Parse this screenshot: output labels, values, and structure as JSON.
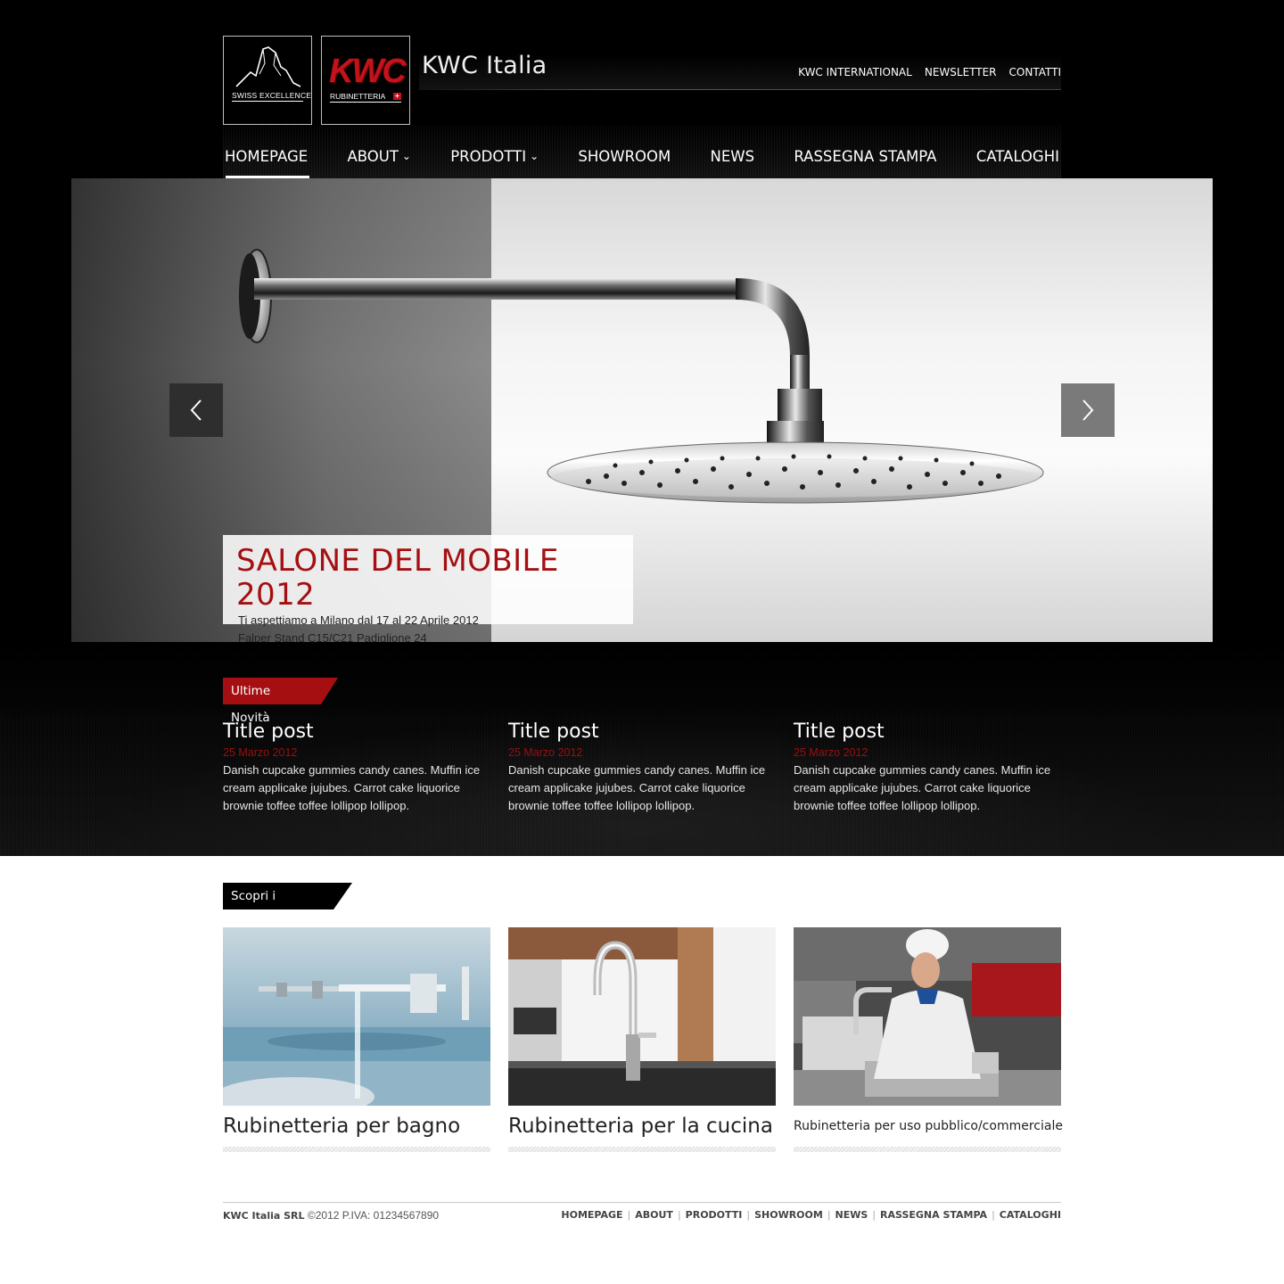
{
  "header": {
    "title": "KWC Italia",
    "logo_swiss_caption": "SWISS EXCELLENCE",
    "logo_kwc_mark": "KWC",
    "logo_kwc_caption": "RUBINETTERIA",
    "top_links": [
      "KWC INTERNATIONAL",
      "NEWSLETTER",
      "CONTATTI"
    ]
  },
  "nav": {
    "items": [
      {
        "label": "HOMEPAGE",
        "active": true
      },
      {
        "label": "ABOUT",
        "dropdown": true
      },
      {
        "label": "PRODOTTI",
        "dropdown": true
      },
      {
        "label": "SHOWROOM"
      },
      {
        "label": "NEWS"
      },
      {
        "label": "RASSEGNA STAMPA"
      },
      {
        "label": "CATALOGHI"
      }
    ]
  },
  "slider": {
    "title": "SALONE DEL MOBILE 2012",
    "line1": "Ti aspettiamo a Milano dal 17 al 22 Aprile 2012",
    "line2": "Falper Stand C15/C21 Padiglione 24",
    "prev_icon": "chevron-left-icon",
    "next_icon": "chevron-right-icon"
  },
  "news": {
    "heading": "Ultime Novità",
    "posts": [
      {
        "title": "Title post",
        "date": "25 Marzo 2012",
        "body": "Danish cupcake gummies candy canes. Muffin ice cream applicake jujubes. Carrot cake liquorice brownie toffee toffee lollipop lollipop."
      },
      {
        "title": "Title post",
        "date": "25 Marzo 2012",
        "body": "Danish cupcake gummies candy canes. Muffin ice cream applicake jujubes. Carrot cake liquorice brownie toffee toffee lollipop lollipop."
      },
      {
        "title": "Title post",
        "date": "25 Marzo 2012",
        "body": "Danish cupcake gummies candy canes. Muffin ice cream applicake jujubes. Carrot cake liquorice brownie toffee toffee lollipop lollipop."
      }
    ]
  },
  "products": {
    "heading": "Scopri i prodotti",
    "items": [
      {
        "label": "Rubinetteria per bagno"
      },
      {
        "label": "Rubinetteria per la cucina"
      },
      {
        "label": "Rubinetteria per uso pubblico/commerciale"
      }
    ]
  },
  "footer": {
    "company": "KWC Italia SRL",
    "copyright": "©2012 P.IVA: 01234567890",
    "links": [
      "HOMEPAGE",
      "ABOUT",
      "PRODOTTI",
      "SHOWROOM",
      "NEWS",
      "RASSEGNA STAMPA",
      "CATALOGHI"
    ]
  },
  "colors": {
    "accent_red": "#a50f12",
    "background_dark": "#000000",
    "background_light": "#ffffff"
  }
}
